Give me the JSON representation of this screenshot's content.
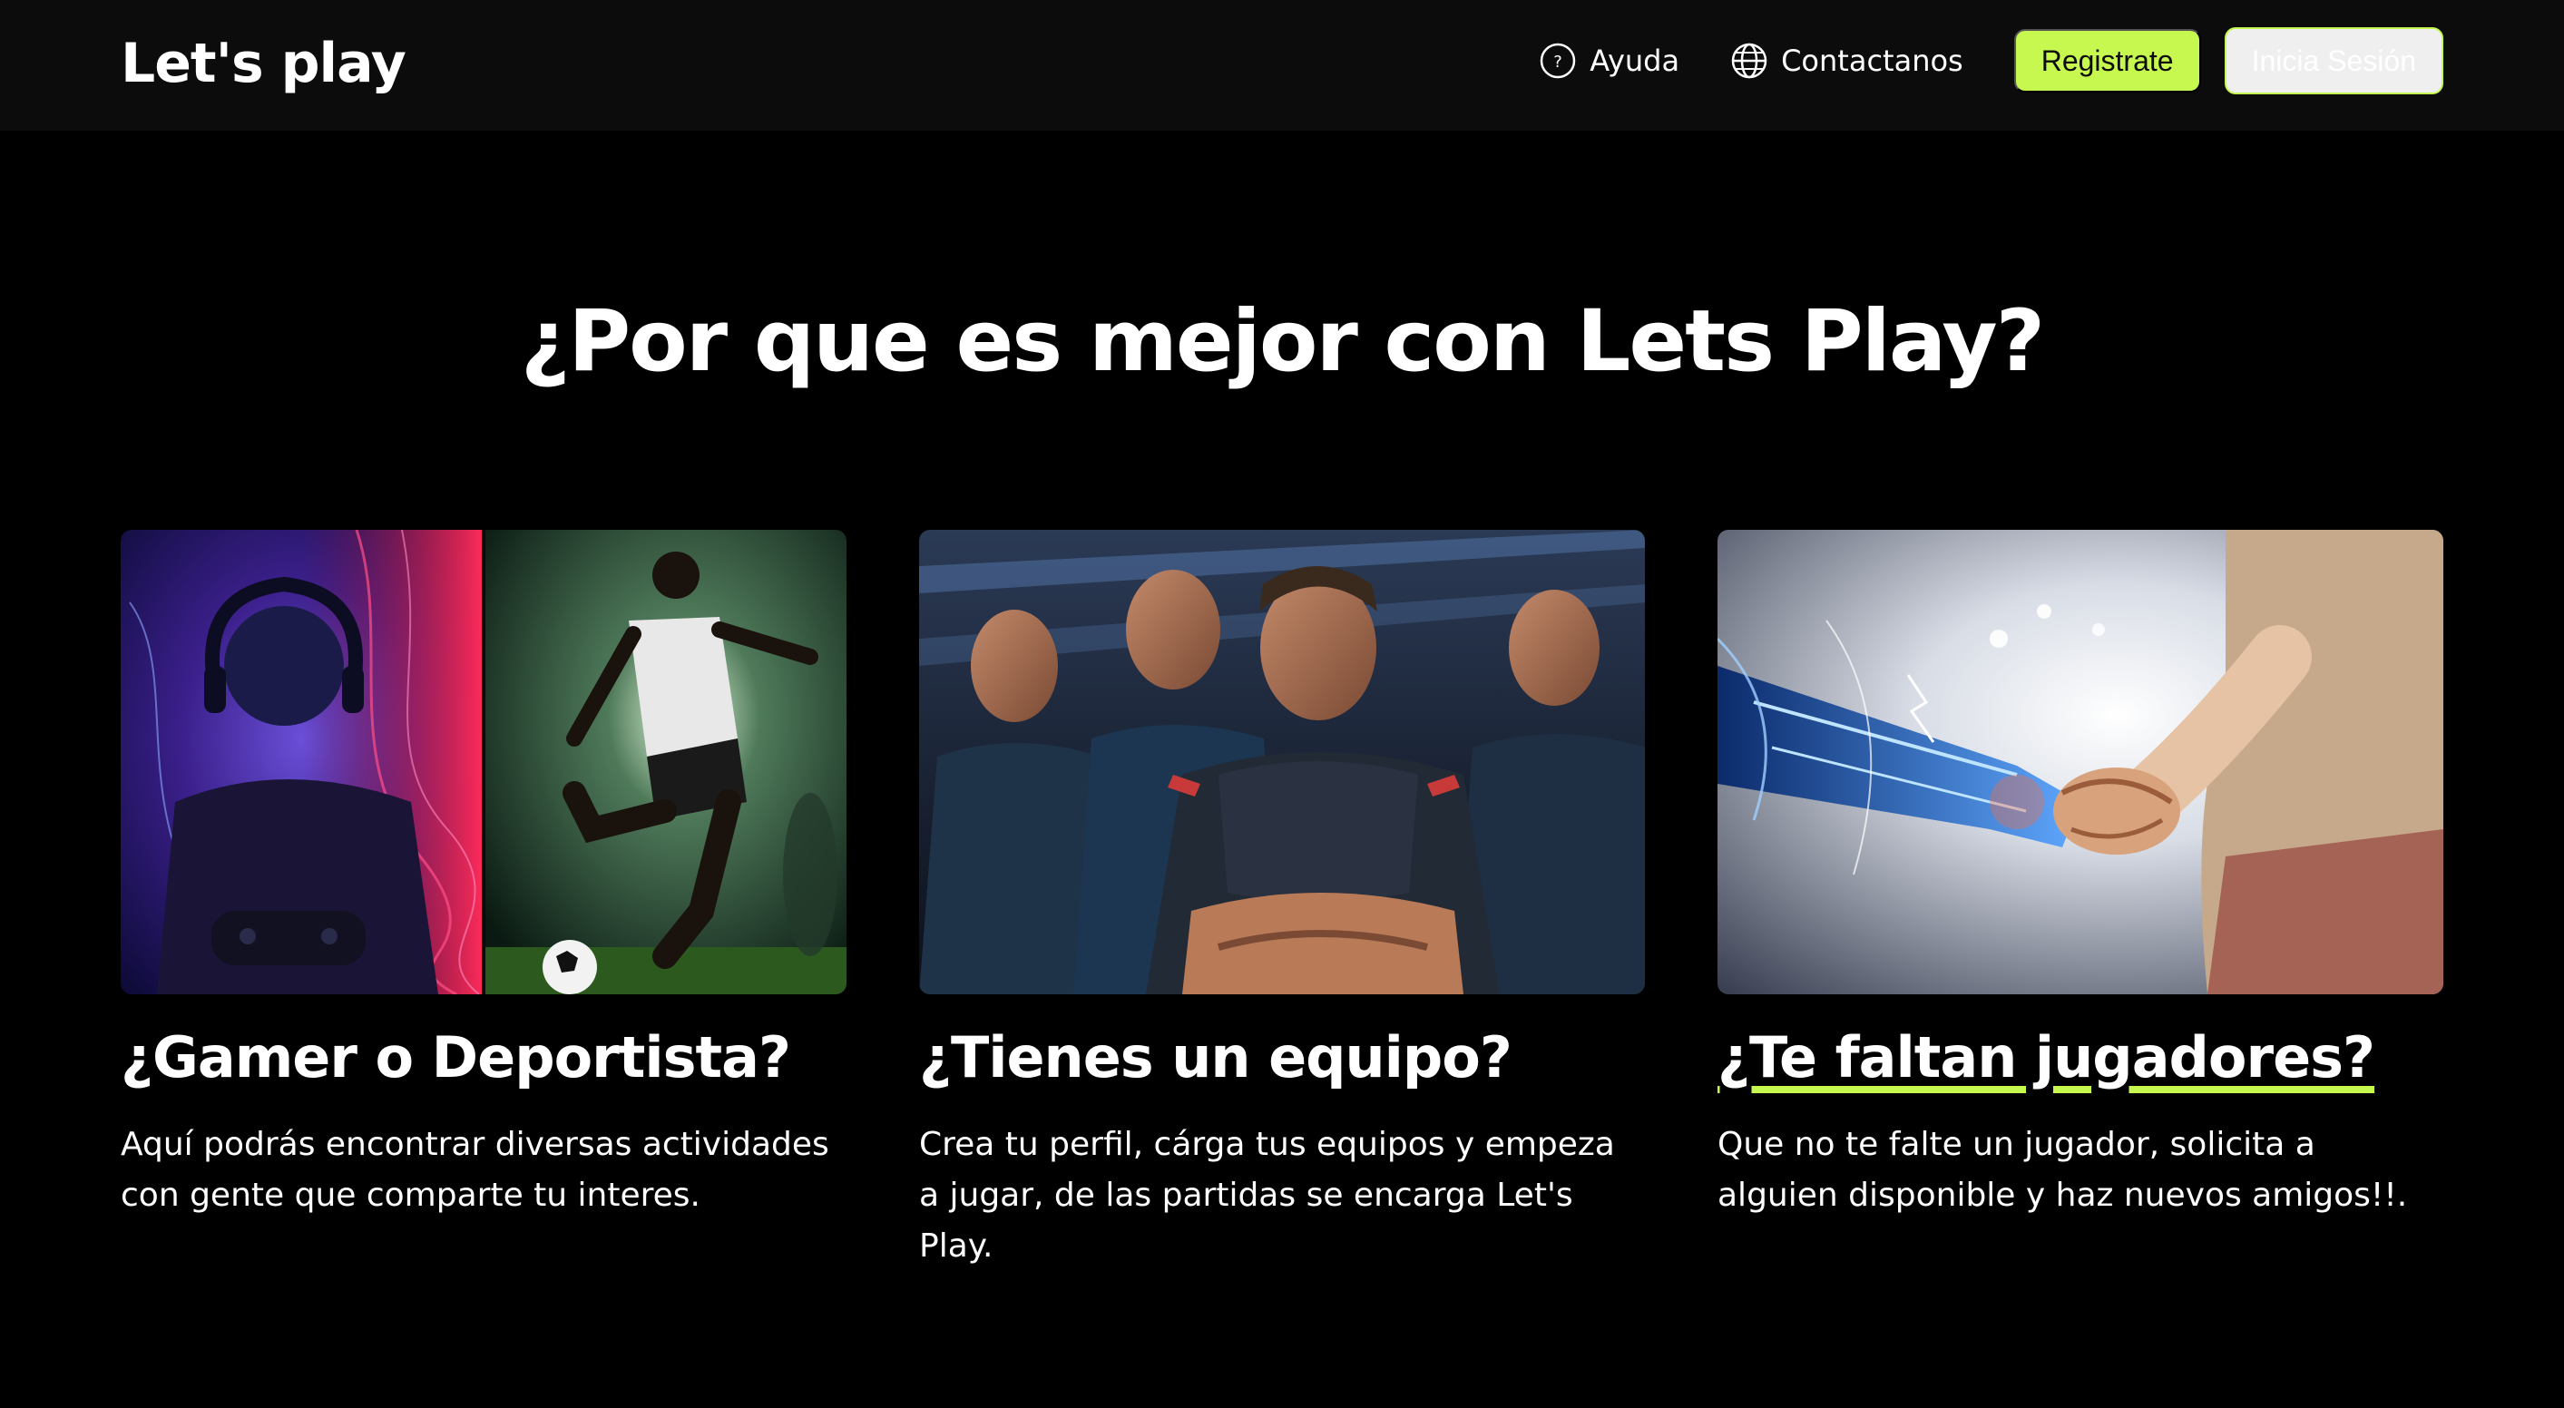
{
  "brand": {
    "name": "Let's play",
    "accent_color": "#c6f84f"
  },
  "nav": {
    "help": {
      "label": "Ayuda",
      "icon": "question-circle-icon"
    },
    "contact": {
      "label": "Contactanos",
      "icon": "globe-icon"
    },
    "register_label": "Registrate",
    "login_label": "Inicia Sesión"
  },
  "main": {
    "title": "¿Por que es mejor con Lets Play?",
    "cards": [
      {
        "title": "¿Gamer o Deportista?",
        "text": "Aquí podrás encontrar diversas actividades con gente que comparte tu interes."
      },
      {
        "title": "¿Tienes un equipo?",
        "text": "Crea tu perfil, cárga tus equipos y empeza a jugar, de las partidas se encarga Let's Play."
      },
      {
        "title": "¿Te faltan jugadores?",
        "text": "Que no te falte un jugador, solicita a alguien disponible y haz nuevos amigos!!."
      }
    ]
  }
}
